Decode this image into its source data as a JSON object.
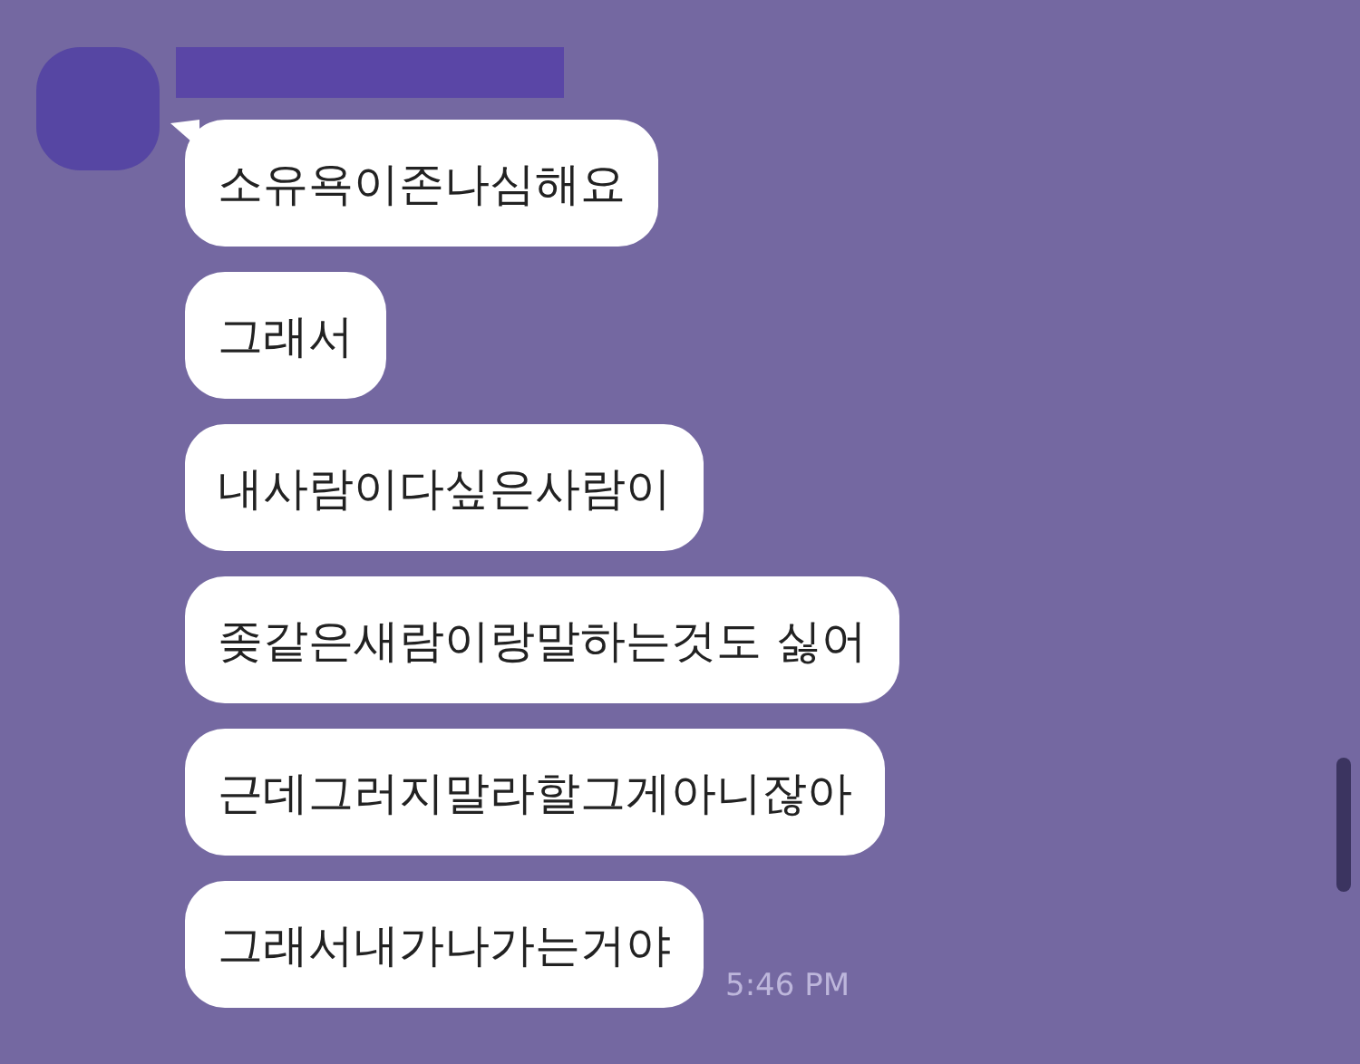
{
  "messages": [
    {
      "text": "소유욕이존나심해요"
    },
    {
      "text": "그래서"
    },
    {
      "text": "내사람이다싶은사람이"
    },
    {
      "text": "좆같은새람이랑말하는것도 싫어"
    },
    {
      "text": "근데그러지말라할그게아니잖아"
    },
    {
      "text": "그래서내가나가는거야",
      "time": "5:46 PM"
    }
  ]
}
